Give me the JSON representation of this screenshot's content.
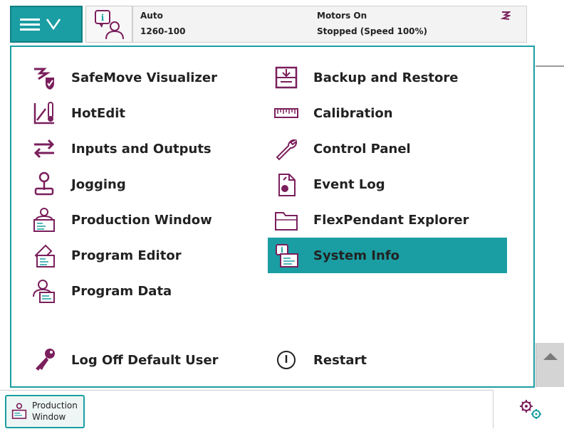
{
  "statusbar": {
    "mode": "Auto",
    "system_name": "1260-100",
    "motors": "Motors On",
    "program_state": "Stopped (Speed 100%)"
  },
  "menu": {
    "left": [
      {
        "label": "SafeMove Visualizer",
        "icon": "safemove-icon"
      },
      {
        "label": "HotEdit",
        "icon": "hotedit-icon"
      },
      {
        "label": "Inputs and Outputs",
        "icon": "io-arrows-icon"
      },
      {
        "label": "Jogging",
        "icon": "joystick-icon"
      },
      {
        "label": "Production Window",
        "icon": "production-window-icon"
      },
      {
        "label": "Program Editor",
        "icon": "program-editor-icon"
      },
      {
        "label": "Program Data",
        "icon": "program-data-icon"
      }
    ],
    "right": [
      {
        "label": "Backup and Restore",
        "icon": "backup-icon"
      },
      {
        "label": "Calibration",
        "icon": "calibration-icon"
      },
      {
        "label": "Control Panel",
        "icon": "wrench-icon"
      },
      {
        "label": "Event Log",
        "icon": "event-log-icon"
      },
      {
        "label": "FlexPendant Explorer",
        "icon": "folder-icon"
      },
      {
        "label": "System Info",
        "icon": "system-info-icon",
        "selected": true
      }
    ],
    "logoff": "Log Off Default User",
    "restart": "Restart"
  },
  "taskbar": {
    "line1": "Production",
    "line2": "Window"
  },
  "colors": {
    "accent": "#1a9ea3",
    "icon": "#7a1f5c"
  }
}
